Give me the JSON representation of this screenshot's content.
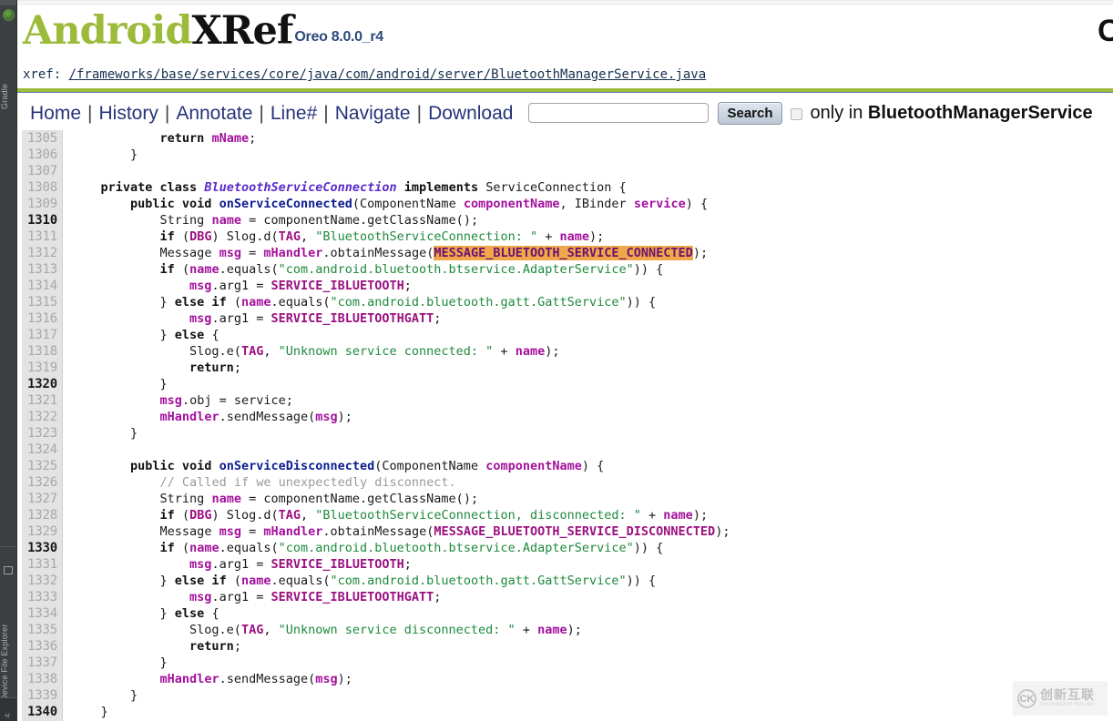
{
  "ide": {
    "left_strip": {
      "gradle_label": "Gradle",
      "gradle_icon": "gradle-elephant-icon",
      "device_file_explorer_label": "Device File Explorer",
      "device_file_explorer_icon": "device-folder-icon",
      "bottom_tab_label": "4:"
    }
  },
  "masthead": {
    "logo_android": "Android",
    "logo_xref": "XRef",
    "logo_version": "Oreo 8.0.0_r4",
    "right_title": "Cro",
    "colors": {
      "android_green": "#9cbb3b",
      "xref_black": "#111111",
      "version_blue": "#2e4a7d"
    }
  },
  "xref": {
    "label": "xref: ",
    "path": "/frameworks/base/services/core/java/com/android/server/BluetoothManagerService.java"
  },
  "nav": {
    "links": [
      "Home",
      "History",
      "Annotate",
      "Line#",
      "Navigate",
      "Download"
    ],
    "separator": "|",
    "search_value": "",
    "search_placeholder": "",
    "search_button": "Search",
    "only_in_prefix": "only in ",
    "only_in_target": "BluetoothManagerService",
    "only_in_checked": false
  },
  "code": {
    "first_line": 1305,
    "highlight_token": "MESSAGE_BLUETOOTH_SERVICE_CONNECTED",
    "highlight_bg": "#f0a74a",
    "lines": [
      {
        "n": 1305,
        "tokens": [
          {
            "t": "            ",
            "c": "pnc"
          },
          {
            "t": "return",
            "c": "kw"
          },
          {
            "t": " ",
            "c": "pnc"
          },
          {
            "t": "mName",
            "c": "var"
          },
          {
            "t": ";",
            "c": "pnc"
          }
        ]
      },
      {
        "n": 1306,
        "tokens": [
          {
            "t": "        }",
            "c": "pnc"
          }
        ]
      },
      {
        "n": 1307,
        "tokens": []
      },
      {
        "n": 1308,
        "tokens": [
          {
            "t": "    ",
            "c": "pnc"
          },
          {
            "t": "private class",
            "c": "kw"
          },
          {
            "t": " ",
            "c": "pnc"
          },
          {
            "t": "BluetoothServiceConnection",
            "c": "cls"
          },
          {
            "t": " ",
            "c": "pnc"
          },
          {
            "t": "implements",
            "c": "kw"
          },
          {
            "t": " ",
            "c": "pnc"
          },
          {
            "t": "ServiceConnection",
            "c": "typ"
          },
          {
            "t": " {",
            "c": "pnc"
          }
        ]
      },
      {
        "n": 1309,
        "tokens": [
          {
            "t": "        ",
            "c": "pnc"
          },
          {
            "t": "public void",
            "c": "kw"
          },
          {
            "t": " ",
            "c": "pnc"
          },
          {
            "t": "onServiceConnected",
            "c": "mth"
          },
          {
            "t": "(",
            "c": "pnc"
          },
          {
            "t": "ComponentName",
            "c": "typ"
          },
          {
            "t": " ",
            "c": "pnc"
          },
          {
            "t": "componentName",
            "c": "var"
          },
          {
            "t": ", ",
            "c": "pnc"
          },
          {
            "t": "IBinder",
            "c": "typ"
          },
          {
            "t": " ",
            "c": "pnc"
          },
          {
            "t": "service",
            "c": "var"
          },
          {
            "t": ") {",
            "c": "pnc"
          }
        ]
      },
      {
        "n": 1310,
        "tokens": [
          {
            "t": "            ",
            "c": "pnc"
          },
          {
            "t": "String",
            "c": "typ"
          },
          {
            "t": " ",
            "c": "pnc"
          },
          {
            "t": "name",
            "c": "var"
          },
          {
            "t": " = componentName.getClassName();",
            "c": "pnc"
          }
        ]
      },
      {
        "n": 1311,
        "tokens": [
          {
            "t": "            ",
            "c": "pnc"
          },
          {
            "t": "if",
            "c": "kw"
          },
          {
            "t": " (",
            "c": "pnc"
          },
          {
            "t": "DBG",
            "c": "cst"
          },
          {
            "t": ") Slog.d(",
            "c": "pnc"
          },
          {
            "t": "TAG",
            "c": "cst"
          },
          {
            "t": ", ",
            "c": "pnc"
          },
          {
            "t": "\"BluetoothServiceConnection: \"",
            "c": "str"
          },
          {
            "t": " + ",
            "c": "pnc"
          },
          {
            "t": "name",
            "c": "var"
          },
          {
            "t": ");",
            "c": "pnc"
          }
        ]
      },
      {
        "n": 1312,
        "tokens": [
          {
            "t": "            ",
            "c": "pnc"
          },
          {
            "t": "Message",
            "c": "typ"
          },
          {
            "t": " ",
            "c": "pnc"
          },
          {
            "t": "msg",
            "c": "var"
          },
          {
            "t": " = ",
            "c": "pnc"
          },
          {
            "t": "mHandler",
            "c": "var"
          },
          {
            "t": ".obtainMessage(",
            "c": "pnc"
          },
          {
            "t": "MESSAGE_BLUETOOTH_SERVICE_CONNECTED",
            "c": "hl"
          },
          {
            "t": ");",
            "c": "pnc"
          }
        ]
      },
      {
        "n": 1313,
        "tokens": [
          {
            "t": "            ",
            "c": "pnc"
          },
          {
            "t": "if",
            "c": "kw"
          },
          {
            "t": " (",
            "c": "pnc"
          },
          {
            "t": "name",
            "c": "var"
          },
          {
            "t": ".equals(",
            "c": "pnc"
          },
          {
            "t": "\"com.android.bluetooth.btservice.AdapterService\"",
            "c": "str"
          },
          {
            "t": ")) {",
            "c": "pnc"
          }
        ]
      },
      {
        "n": 1314,
        "tokens": [
          {
            "t": "                ",
            "c": "pnc"
          },
          {
            "t": "msg",
            "c": "var"
          },
          {
            "t": ".arg1 = ",
            "c": "pnc"
          },
          {
            "t": "SERVICE_IBLUETOOTH",
            "c": "cst"
          },
          {
            "t": ";",
            "c": "pnc"
          }
        ]
      },
      {
        "n": 1315,
        "tokens": [
          {
            "t": "            } ",
            "c": "pnc"
          },
          {
            "t": "else if",
            "c": "kw"
          },
          {
            "t": " (",
            "c": "pnc"
          },
          {
            "t": "name",
            "c": "var"
          },
          {
            "t": ".equals(",
            "c": "pnc"
          },
          {
            "t": "\"com.android.bluetooth.gatt.GattService\"",
            "c": "str"
          },
          {
            "t": ")) {",
            "c": "pnc"
          }
        ]
      },
      {
        "n": 1316,
        "tokens": [
          {
            "t": "                ",
            "c": "pnc"
          },
          {
            "t": "msg",
            "c": "var"
          },
          {
            "t": ".arg1 = ",
            "c": "pnc"
          },
          {
            "t": "SERVICE_IBLUETOOTHGATT",
            "c": "cst"
          },
          {
            "t": ";",
            "c": "pnc"
          }
        ]
      },
      {
        "n": 1317,
        "tokens": [
          {
            "t": "            } ",
            "c": "pnc"
          },
          {
            "t": "else",
            "c": "kw"
          },
          {
            "t": " {",
            "c": "pnc"
          }
        ]
      },
      {
        "n": 1318,
        "tokens": [
          {
            "t": "                Slog.e(",
            "c": "pnc"
          },
          {
            "t": "TAG",
            "c": "cst"
          },
          {
            "t": ", ",
            "c": "pnc"
          },
          {
            "t": "\"Unknown service connected: \"",
            "c": "str"
          },
          {
            "t": " + ",
            "c": "pnc"
          },
          {
            "t": "name",
            "c": "var"
          },
          {
            "t": ");",
            "c": "pnc"
          }
        ]
      },
      {
        "n": 1319,
        "tokens": [
          {
            "t": "                ",
            "c": "pnc"
          },
          {
            "t": "return",
            "c": "kw"
          },
          {
            "t": ";",
            "c": "pnc"
          }
        ]
      },
      {
        "n": 1320,
        "tokens": [
          {
            "t": "            }",
            "c": "pnc"
          }
        ]
      },
      {
        "n": 1321,
        "tokens": [
          {
            "t": "            ",
            "c": "pnc"
          },
          {
            "t": "msg",
            "c": "var"
          },
          {
            "t": ".obj = service;",
            "c": "pnc"
          }
        ]
      },
      {
        "n": 1322,
        "tokens": [
          {
            "t": "            ",
            "c": "pnc"
          },
          {
            "t": "mHandler",
            "c": "var"
          },
          {
            "t": ".sendMessage(",
            "c": "pnc"
          },
          {
            "t": "msg",
            "c": "var"
          },
          {
            "t": ");",
            "c": "pnc"
          }
        ]
      },
      {
        "n": 1323,
        "tokens": [
          {
            "t": "        }",
            "c": "pnc"
          }
        ]
      },
      {
        "n": 1324,
        "tokens": []
      },
      {
        "n": 1325,
        "tokens": [
          {
            "t": "        ",
            "c": "pnc"
          },
          {
            "t": "public void",
            "c": "kw"
          },
          {
            "t": " ",
            "c": "pnc"
          },
          {
            "t": "onServiceDisconnected",
            "c": "mth"
          },
          {
            "t": "(",
            "c": "pnc"
          },
          {
            "t": "ComponentName",
            "c": "typ"
          },
          {
            "t": " ",
            "c": "pnc"
          },
          {
            "t": "componentName",
            "c": "var"
          },
          {
            "t": ") {",
            "c": "pnc"
          }
        ]
      },
      {
        "n": 1326,
        "tokens": [
          {
            "t": "            ",
            "c": "pnc"
          },
          {
            "t": "// Called if we unexpectedly disconnect.",
            "c": "cmt"
          }
        ]
      },
      {
        "n": 1327,
        "tokens": [
          {
            "t": "            ",
            "c": "pnc"
          },
          {
            "t": "String",
            "c": "typ"
          },
          {
            "t": " ",
            "c": "pnc"
          },
          {
            "t": "name",
            "c": "var"
          },
          {
            "t": " = componentName.getClassName();",
            "c": "pnc"
          }
        ]
      },
      {
        "n": 1328,
        "tokens": [
          {
            "t": "            ",
            "c": "pnc"
          },
          {
            "t": "if",
            "c": "kw"
          },
          {
            "t": " (",
            "c": "pnc"
          },
          {
            "t": "DBG",
            "c": "cst"
          },
          {
            "t": ") Slog.d(",
            "c": "pnc"
          },
          {
            "t": "TAG",
            "c": "cst"
          },
          {
            "t": ", ",
            "c": "pnc"
          },
          {
            "t": "\"BluetoothServiceConnection, disconnected: \"",
            "c": "str"
          },
          {
            "t": " + ",
            "c": "pnc"
          },
          {
            "t": "name",
            "c": "var"
          },
          {
            "t": ");",
            "c": "pnc"
          }
        ]
      },
      {
        "n": 1329,
        "tokens": [
          {
            "t": "            ",
            "c": "pnc"
          },
          {
            "t": "Message",
            "c": "typ"
          },
          {
            "t": " ",
            "c": "pnc"
          },
          {
            "t": "msg",
            "c": "var"
          },
          {
            "t": " = ",
            "c": "pnc"
          },
          {
            "t": "mHandler",
            "c": "var"
          },
          {
            "t": ".obtainMessage(",
            "c": "pnc"
          },
          {
            "t": "MESSAGE_BLUETOOTH_SERVICE_DISCONNECTED",
            "c": "cst"
          },
          {
            "t": ");",
            "c": "pnc"
          }
        ]
      },
      {
        "n": 1330,
        "tokens": [
          {
            "t": "            ",
            "c": "pnc"
          },
          {
            "t": "if",
            "c": "kw"
          },
          {
            "t": " (",
            "c": "pnc"
          },
          {
            "t": "name",
            "c": "var"
          },
          {
            "t": ".equals(",
            "c": "pnc"
          },
          {
            "t": "\"com.android.bluetooth.btservice.AdapterService\"",
            "c": "str"
          },
          {
            "t": ")) {",
            "c": "pnc"
          }
        ]
      },
      {
        "n": 1331,
        "tokens": [
          {
            "t": "                ",
            "c": "pnc"
          },
          {
            "t": "msg",
            "c": "var"
          },
          {
            "t": ".arg1 = ",
            "c": "pnc"
          },
          {
            "t": "SERVICE_IBLUETOOTH",
            "c": "cst"
          },
          {
            "t": ";",
            "c": "pnc"
          }
        ]
      },
      {
        "n": 1332,
        "tokens": [
          {
            "t": "            } ",
            "c": "pnc"
          },
          {
            "t": "else if",
            "c": "kw"
          },
          {
            "t": " (",
            "c": "pnc"
          },
          {
            "t": "name",
            "c": "var"
          },
          {
            "t": ".equals(",
            "c": "pnc"
          },
          {
            "t": "\"com.android.bluetooth.gatt.GattService\"",
            "c": "str"
          },
          {
            "t": ")) {",
            "c": "pnc"
          }
        ]
      },
      {
        "n": 1333,
        "tokens": [
          {
            "t": "                ",
            "c": "pnc"
          },
          {
            "t": "msg",
            "c": "var"
          },
          {
            "t": ".arg1 = ",
            "c": "pnc"
          },
          {
            "t": "SERVICE_IBLUETOOTHGATT",
            "c": "cst"
          },
          {
            "t": ";",
            "c": "pnc"
          }
        ]
      },
      {
        "n": 1334,
        "tokens": [
          {
            "t": "            } ",
            "c": "pnc"
          },
          {
            "t": "else",
            "c": "kw"
          },
          {
            "t": " {",
            "c": "pnc"
          }
        ]
      },
      {
        "n": 1335,
        "tokens": [
          {
            "t": "                Slog.e(",
            "c": "pnc"
          },
          {
            "t": "TAG",
            "c": "cst"
          },
          {
            "t": ", ",
            "c": "pnc"
          },
          {
            "t": "\"Unknown service disconnected: \"",
            "c": "str"
          },
          {
            "t": " + ",
            "c": "pnc"
          },
          {
            "t": "name",
            "c": "var"
          },
          {
            "t": ");",
            "c": "pnc"
          }
        ]
      },
      {
        "n": 1336,
        "tokens": [
          {
            "t": "                ",
            "c": "pnc"
          },
          {
            "t": "return",
            "c": "kw"
          },
          {
            "t": ";",
            "c": "pnc"
          }
        ]
      },
      {
        "n": 1337,
        "tokens": [
          {
            "t": "            }",
            "c": "pnc"
          }
        ]
      },
      {
        "n": 1338,
        "tokens": [
          {
            "t": "            ",
            "c": "pnc"
          },
          {
            "t": "mHandler",
            "c": "var"
          },
          {
            "t": ".sendMessage(",
            "c": "pnc"
          },
          {
            "t": "msg",
            "c": "var"
          },
          {
            "t": ");",
            "c": "pnc"
          }
        ]
      },
      {
        "n": 1339,
        "tokens": [
          {
            "t": "        }",
            "c": "pnc"
          }
        ]
      },
      {
        "n": 1340,
        "tokens": [
          {
            "t": "    }",
            "c": "pnc"
          }
        ]
      }
    ]
  },
  "watermark": {
    "logo_text": "CK",
    "cn_text": "创新互联",
    "en_text": "CHUANGXIN  HULIAN"
  }
}
